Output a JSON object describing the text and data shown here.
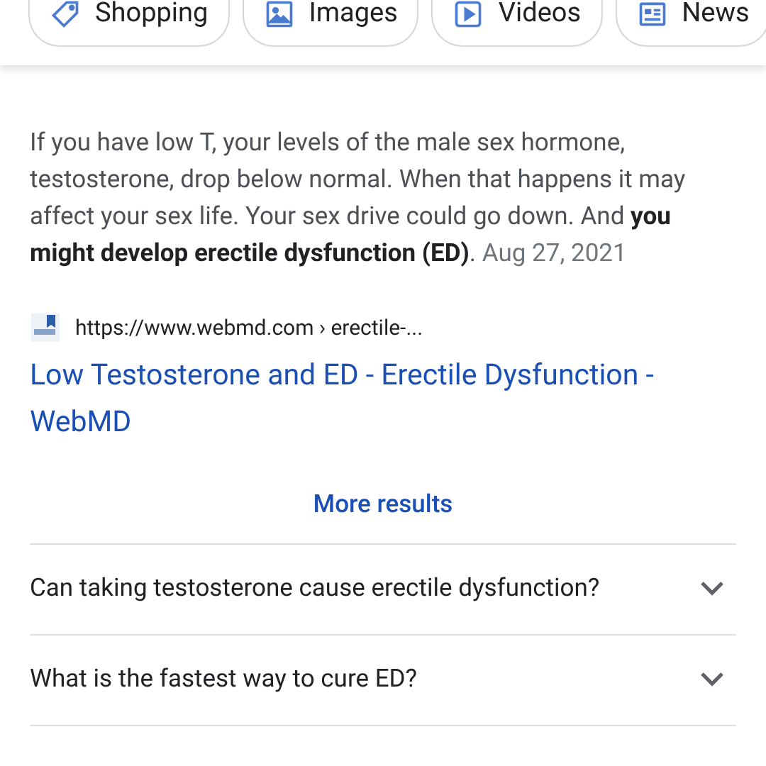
{
  "chips": [
    {
      "kind": "tag",
      "label": "Shopping"
    },
    {
      "kind": "image",
      "label": "Images"
    },
    {
      "kind": "video",
      "label": "Videos"
    },
    {
      "kind": "news",
      "label": "News"
    }
  ],
  "snippet": {
    "text": "If you have low T, your levels of the male sex hormone, testosterone, drop below normal. When that happens it may affect your sex life. Your sex drive could go down. And **you might develop erectile dysfunction (ED)**.",
    "date": "Aug 27, 2021"
  },
  "result": {
    "url": "https://www.webmd.com › erectile-...",
    "title": "Low Testosterone and ED - Erectile Dysfunction - WebMD"
  },
  "more_results": "More results",
  "questions": [
    {
      "text": "Can taking testosterone cause erectile dysfunction?",
      "expanded": false
    },
    {
      "text": "What is the fastest way to cure ED?",
      "expanded": false
    }
  ]
}
